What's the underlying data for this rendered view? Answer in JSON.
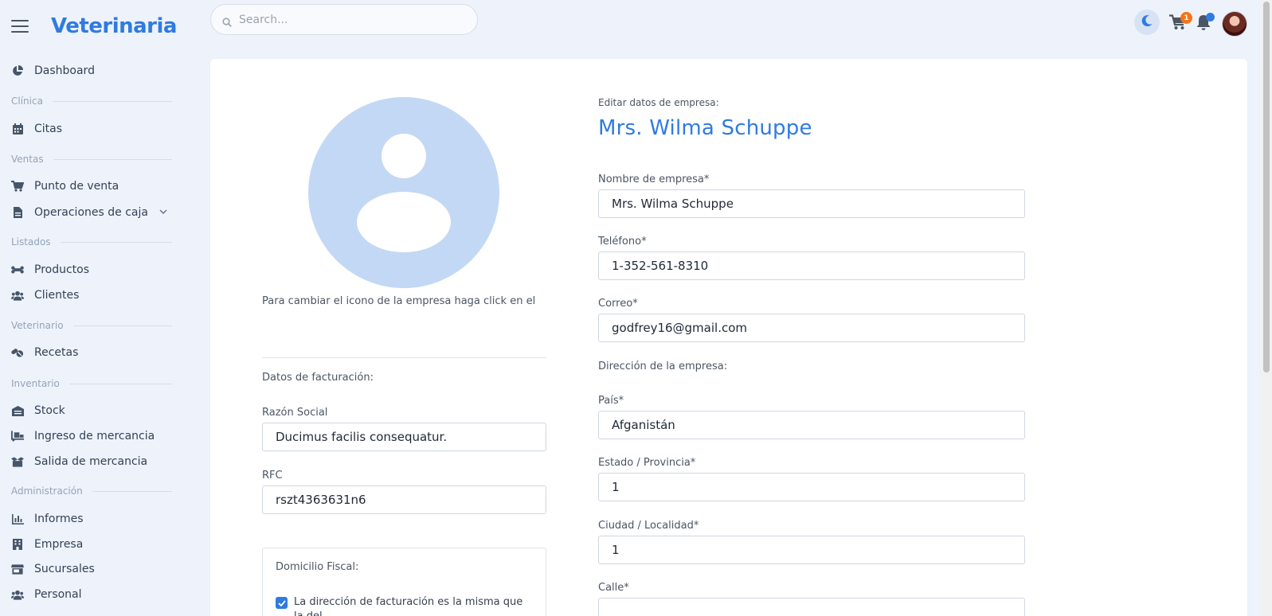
{
  "app": {
    "brand": "Veterinaria"
  },
  "search": {
    "placeholder": "Search..."
  },
  "topbar": {
    "cart_count": "1"
  },
  "sidebar": {
    "items": [
      {
        "label": "Dashboard",
        "icon": "pie-chart-icon"
      },
      {
        "section": "Clínica"
      },
      {
        "label": "Citas",
        "icon": "calendar-icon"
      },
      {
        "section": "Ventas"
      },
      {
        "label": "Punto de venta",
        "icon": "cart-icon"
      },
      {
        "label": "Operaciones de caja",
        "icon": "document-icon"
      },
      {
        "section": "Listados"
      },
      {
        "label": "Productos",
        "icon": "bone-icon"
      },
      {
        "label": "Clientes",
        "icon": "users-icon"
      },
      {
        "section": "Veterinario"
      },
      {
        "label": "Recetas",
        "icon": "pills-icon"
      },
      {
        "section": "Inventario"
      },
      {
        "label": "Stock",
        "icon": "warehouse-icon"
      },
      {
        "label": "Ingreso de mercancia",
        "icon": "dolly-icon"
      },
      {
        "label": "Salida de mercancia",
        "icon": "box-open-icon"
      },
      {
        "section": "Administración"
      },
      {
        "label": "Informes",
        "icon": "bar-chart-icon"
      },
      {
        "label": "Empresa",
        "icon": "building-icon"
      },
      {
        "label": "Sucursales",
        "icon": "store-icon"
      },
      {
        "label": "Personal",
        "icon": "users-icon"
      }
    ]
  },
  "left_panel": {
    "icon_hint": "Para cambiar el icono de la empresa haga click en el",
    "billing_title": "Datos de facturación:",
    "razon_social_label": "Razón Social",
    "razon_social_value": "Ducimus facilis consequatur.",
    "rfc_label": "RFC",
    "rfc_value": "rszt4363631n6",
    "fiscal_title": "Domicilio Fiscal:",
    "same_address_label": "La dirección de facturación es la misma que la del..."
  },
  "right_panel": {
    "caption": "Editar datos de empresa:",
    "company_name": "Mrs. Wilma Schuppe",
    "nombre_label": "Nombre de empresa*",
    "nombre_value": "Mrs. Wilma Schuppe",
    "telefono_label": "Teléfono*",
    "telefono_value": "1-352-561-8310",
    "correo_label": "Correo*",
    "correo_value": "godfrey16@gmail.com",
    "direccion_title": "Dirección de la empresa:",
    "pais_label": "País*",
    "pais_value": "Afganistán",
    "estado_label": "Estado / Provincia*",
    "estado_value": "1",
    "ciudad_label": "Ciudad / Localidad*",
    "ciudad_value": "1",
    "calle_label": "Calle*"
  },
  "colors": {
    "brand": "#2f7be0",
    "badge": "#f97316",
    "avatar_placeholder": "#c3d8f5"
  }
}
